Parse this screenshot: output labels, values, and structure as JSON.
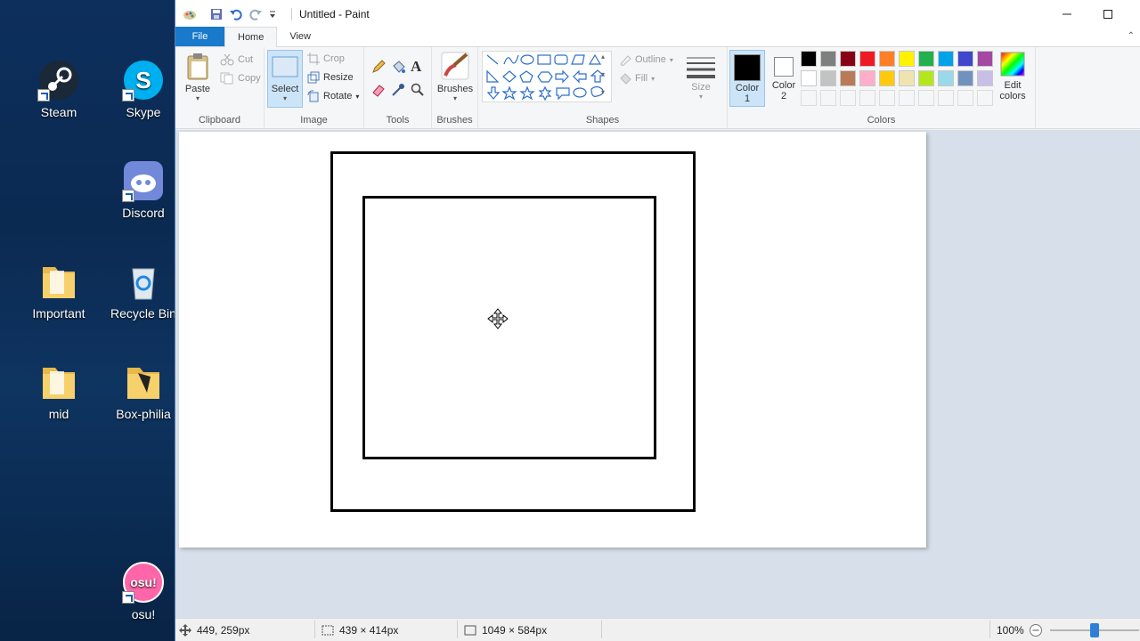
{
  "desktop": {
    "icons": [
      {
        "label": "Steam"
      },
      {
        "label": "Skype"
      },
      {
        "label": "Discord"
      },
      {
        "label": "Important"
      },
      {
        "label": "Recycle Bin"
      },
      {
        "label": "mid"
      },
      {
        "label": "Box-philia"
      },
      {
        "label": "osu!"
      }
    ]
  },
  "window": {
    "title": "Untitled - Paint",
    "tabs": {
      "file": "File",
      "home": "Home",
      "view": "View"
    }
  },
  "ribbon": {
    "clipboard": {
      "paste": "Paste",
      "cut": "Cut",
      "copy": "Copy",
      "label": "Clipboard"
    },
    "image": {
      "select": "Select",
      "crop": "Crop",
      "resize": "Resize",
      "rotate": "Rotate",
      "label": "Image"
    },
    "tools": {
      "label": "Tools"
    },
    "brushes": {
      "label": "Brushes"
    },
    "shapes": {
      "outline": "Outline",
      "fill": "Fill",
      "label": "Shapes"
    },
    "size": {
      "label": "Size"
    },
    "colors": {
      "color1": "Color",
      "color1_num": "1",
      "color2": "Color",
      "color2_num": "2",
      "edit": "Edit",
      "edit2": "colors",
      "label": "Colors",
      "color1_value": "#000000",
      "color2_value": "#ffffff",
      "palette": [
        "#000000",
        "#7f7f7f",
        "#880015",
        "#ed1c24",
        "#ff7f27",
        "#fff200",
        "#22b14c",
        "#00a2e8",
        "#3f48cc",
        "#a349a4",
        "#ffffff",
        "#c3c3c3",
        "#b97a57",
        "#ffaec9",
        "#ffc90e",
        "#efe4b0",
        "#b5e61d",
        "#99d9ea",
        "#7092be",
        "#c8bfe7"
      ]
    }
  },
  "status": {
    "cursor_pos": "449, 259px",
    "selection_size": "439 × 414px",
    "image_size": "1049 × 584px",
    "zoom": "100%",
    "zoom_level": 0.5
  }
}
